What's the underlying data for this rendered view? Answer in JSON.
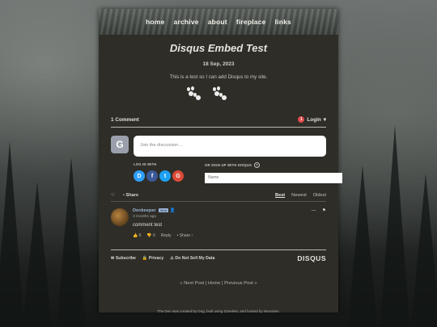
{
  "nav": {
    "items": [
      "home",
      "archive",
      "about",
      "fireplace",
      "links"
    ]
  },
  "post": {
    "title": "Disqus Embed Test",
    "date": "18 Sep, 2023",
    "intro": "This is a test so I can add Disqus to my site."
  },
  "disqus": {
    "comment_count": "1 Comment",
    "login": "Login",
    "login_badge": "1",
    "guest_avatar_letter": "G",
    "join_placeholder": "Join the discussion…",
    "log_in_with": "LOG IN WITH",
    "or_sign_up": "OR SIGN UP WITH DISQUS",
    "help_glyph": "?",
    "name_placeholder": "Name",
    "socials": [
      {
        "letter": "D",
        "color": "#2e9fff"
      },
      {
        "letter": "f",
        "color": "#3b5998"
      },
      {
        "letter": "t",
        "color": "#1da1f2"
      },
      {
        "letter": "G",
        "color": "#dd4b39"
      }
    ],
    "share": "Share",
    "sort": [
      "Best",
      "Newest",
      "Oldest"
    ],
    "comment": {
      "author": "Denkeeper",
      "badge": "Mod",
      "time": "3 months ago",
      "text": "comment test",
      "upvotes": "0",
      "downvotes": "0",
      "reply": "Reply",
      "share": "Share ›"
    },
    "footer": {
      "subscribe": "Subscribe",
      "privacy": "Privacy",
      "do_not_sell": "Do Not Sell My Data",
      "logo": "DISQUS"
    }
  },
  "post_nav": {
    "next": "« Next Post",
    "home": "Home",
    "previous": "Previous Post »"
  },
  "site_footer": "The Den was created by Dog, built using Zonelets, and hosted by Neocities."
}
